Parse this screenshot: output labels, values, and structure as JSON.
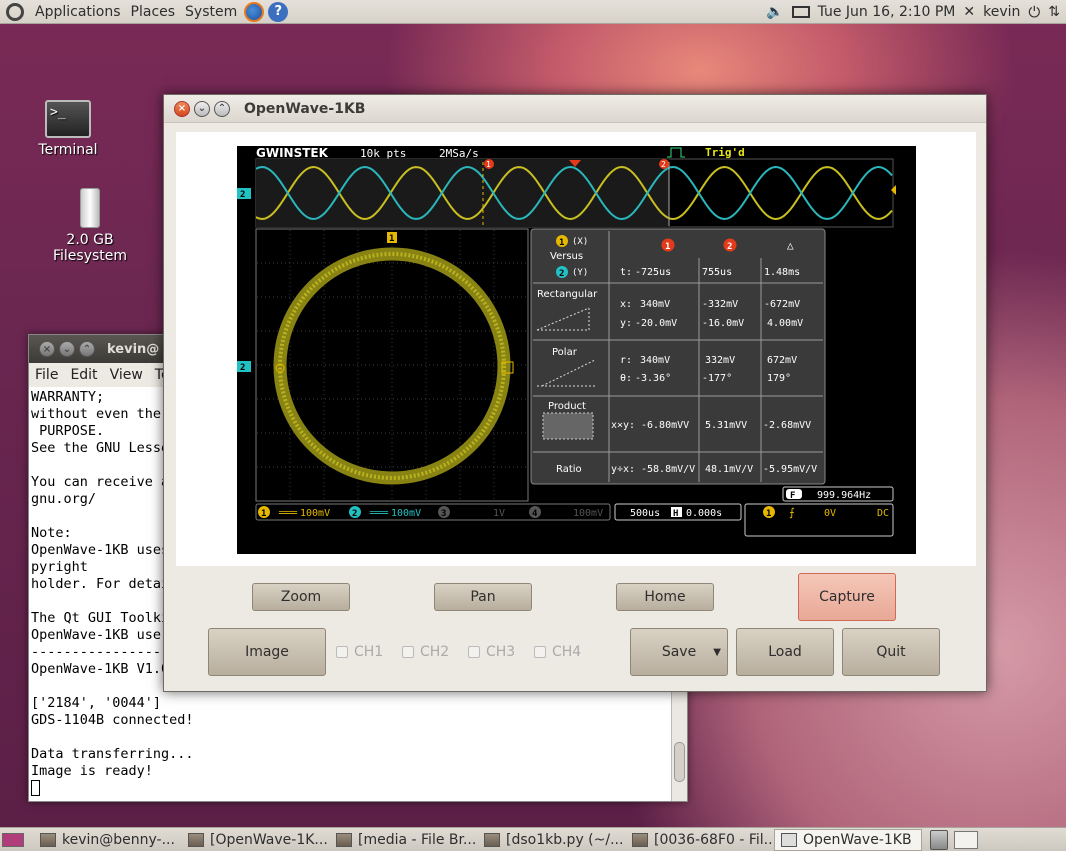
{
  "top_panel": {
    "menus": [
      "Applications",
      "Places",
      "System"
    ],
    "datetime": "Tue Jun 16,  2:10 PM",
    "user": "kevin"
  },
  "desktop": {
    "icons": [
      {
        "label": "Terminal"
      },
      {
        "label": "2.0 GB Filesystem"
      }
    ]
  },
  "terminal": {
    "title": "kevin@",
    "menus": [
      "File",
      "Edit",
      "View",
      "Ter"
    ],
    "lines": [
      "WARRANTY;",
      "without even the",
      " PURPOSE.",
      "See the GNU Lesse",
      "",
      "You can receive a",
      "gnu.org/",
      "",
      "Note:",
      "OpenWave-1KB uses",
      "pyright",
      "holder. For detai",
      "",
      "The Qt GUI Toolki",
      "OpenWave-1KB use",
      "----------------------",
      "OpenWave-1KB V1.0",
      "",
      "['2184', '0044']",
      "GDS-1104B connected!",
      "",
      "Data transferring...",
      "Image is ready!"
    ]
  },
  "openwave": {
    "title": "OpenWave-1KB",
    "buttons": {
      "zoom": "Zoom",
      "pan": "Pan",
      "home": "Home",
      "capture": "Capture",
      "image": "Image",
      "save": "Save",
      "load": "Load",
      "quit": "Quit"
    },
    "channels": [
      "CH1",
      "CH2",
      "CH3",
      "CH4"
    ]
  },
  "scope": {
    "brand": "GWINSTEK",
    "points": "10k pts",
    "rate": "2MSa/s",
    "trig": "Trig'd",
    "table": {
      "ch_x": "(X)",
      "versus": "Versus",
      "ch_y": "(Y)",
      "col1": "1",
      "col2": "2",
      "delta": "△",
      "t_label": "t:",
      "t": [
        "-725us",
        "755us",
        "1.48ms"
      ],
      "rect": "Rectangular",
      "x_label": "x:",
      "y_label": "y:",
      "x": [
        "340mV",
        "-332mV",
        "-672mV"
      ],
      "y": [
        "-20.0mV",
        "-16.0mV",
        "4.00mV"
      ],
      "polar": "Polar",
      "r_label": "r:",
      "th_label": "θ:",
      "r": [
        "340mV",
        "332mV",
        "672mV"
      ],
      "th": [
        "-3.36°",
        "-177°",
        "179°"
      ],
      "product": "Product",
      "prod_label": "x×y:",
      "prod": [
        "-6.80mVV",
        "5.31mVV",
        "-2.68mVV"
      ],
      "ratio": "Ratio",
      "ratio_label": "y÷x:",
      "ratio_v": [
        "-58.8mV/V",
        "48.1mV/V",
        "-5.95mV/V"
      ]
    },
    "freq": "999.964Hz",
    "ch1_scale": "100mV",
    "ch2_scale": "100mV",
    "ch3_scale": "1V",
    "ch4_scale": "100mV",
    "timebase": "500us",
    "hpos": "0.000s",
    "trig_level": "0V",
    "coupling": "DC",
    "cursor1": "1",
    "cursor2": "2",
    "f_badge": "F",
    "h_badge": "H"
  },
  "taskbar": {
    "tasks": [
      "kevin@benny-...",
      "[OpenWave-1K...",
      "[media - File Br...",
      "[dso1kb.py (~/...",
      "[0036-68F0 - Fil...",
      "OpenWave-1KB"
    ]
  },
  "colors": {
    "ch1": "#d7c81e",
    "ch2": "#22c1c3",
    "ch3": "#888888"
  }
}
